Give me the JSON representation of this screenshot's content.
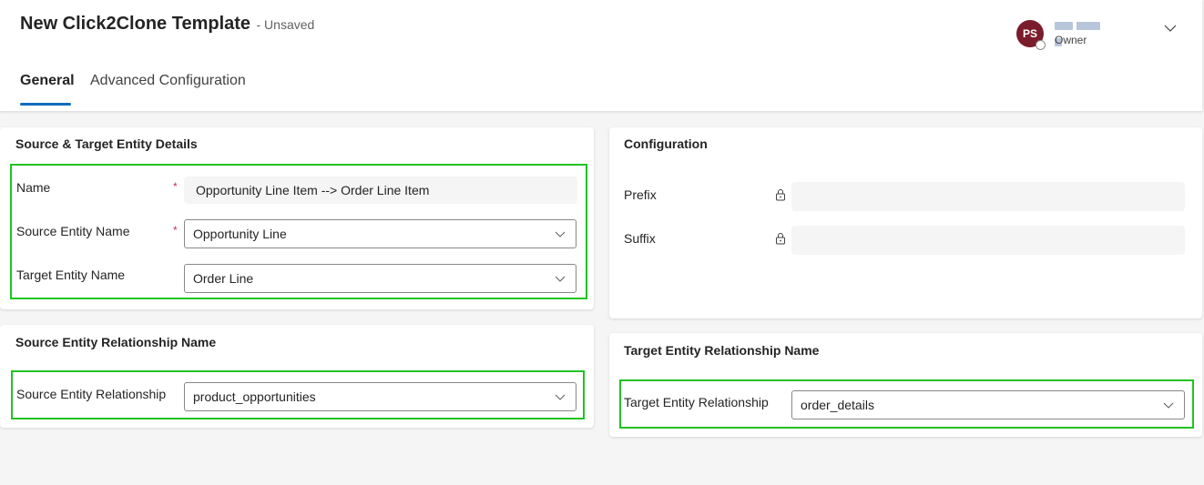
{
  "header": {
    "title": "New Click2Clone Template",
    "status": "- Unsaved",
    "owner": {
      "initials": "PS",
      "role": "Owner",
      "avatar_color": "#7a1c2b"
    }
  },
  "tabs": [
    {
      "label": "General",
      "active": true
    },
    {
      "label": "Advanced Configuration",
      "active": false
    }
  ],
  "colors": {
    "accent": "#0f6cbd",
    "highlight": "#22c322",
    "required": "#c4314b"
  },
  "source_target": {
    "title": "Source & Target Entity Details",
    "fields": {
      "name": {
        "label": "Name",
        "value": "Opportunity Line Item --> Order Line Item",
        "required": "*"
      },
      "source_entity": {
        "label": "Source Entity Name",
        "value": "Opportunity Line",
        "required": "*"
      },
      "target_entity": {
        "label": "Target Entity Name",
        "value": "Order Line"
      }
    }
  },
  "configuration": {
    "title": "Configuration",
    "prefix": {
      "label": "Prefix",
      "value": ""
    },
    "suffix": {
      "label": "Suffix",
      "value": ""
    }
  },
  "source_relationship": {
    "title": "Source Entity Relationship Name",
    "label": "Source Entity Relationship",
    "value": "product_opportunities"
  },
  "target_relationship": {
    "title": "Target Entity Relationship Name",
    "label": "Target Entity Relationship",
    "value": "order_details"
  },
  "icons": {
    "chevron": "chevron-down-icon",
    "lock": "lock-icon"
  }
}
